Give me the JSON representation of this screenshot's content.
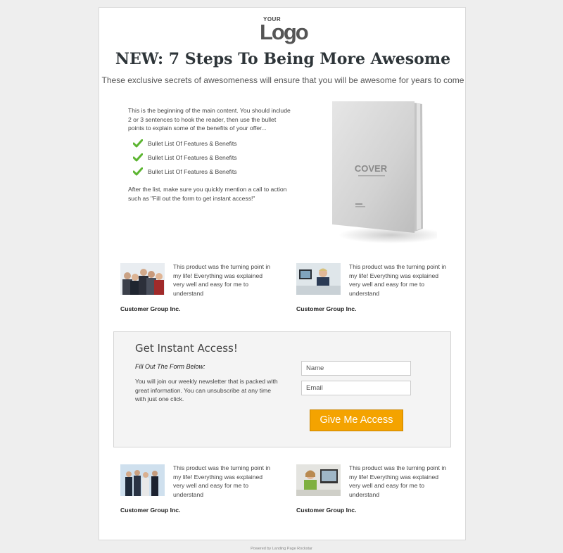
{
  "logo": {
    "small": "YOUR",
    "big": "Logo"
  },
  "headline": "NEW: 7 Steps To Being More Awesome",
  "subhead": "These exclusive secrets of awesomeness will ensure that you will be awesome for years to come",
  "intro": "This is the beginning of the main content. You should include 2 or 3 sentences to hook the reader, then use the bullet points to explain some of the benefits of your offer...",
  "bullets": [
    "Bullet List Of Features & Benefits",
    "Bullet List Of Features & Benefits",
    "Bullet List Of Features & Benefits"
  ],
  "outro": "After the list, make sure you quickly mention a call to action such as \"Fill out the form to get instant access!\"",
  "book": {
    "cover": "COVER",
    "icon": "product-cover-image"
  },
  "testimonials": [
    {
      "quote": "This product was the turning point in my life! Everything was explained very well and easy for me to understand",
      "author": "Customer Group Inc."
    },
    {
      "quote": "This product was the turning point in my life! Everything was explained very well and easy for me to understand",
      "author": "Customer Group Inc."
    },
    {
      "quote": "This product was the turning point in my life! Everything was explained very well and easy for me to understand",
      "author": "Customer Group Inc."
    },
    {
      "quote": "This product was the turning point in my life! Everything was explained very well and easy for me to understand",
      "author": "Customer Group Inc."
    }
  ],
  "optin": {
    "title": "Get Instant Access!",
    "lead": "Fill Out The Form Below:",
    "text": "You will join our weekly newsletter that is packed with great information. You can unsubscribe at any time with just one click.",
    "name_placeholder": "Name",
    "email_placeholder": "Email",
    "button": "Give Me Access"
  },
  "footer": "Powered by Landing Page Rockstar",
  "colors": {
    "accent": "#f4a300",
    "check": "#5cb531",
    "headline": "#2e3539"
  }
}
